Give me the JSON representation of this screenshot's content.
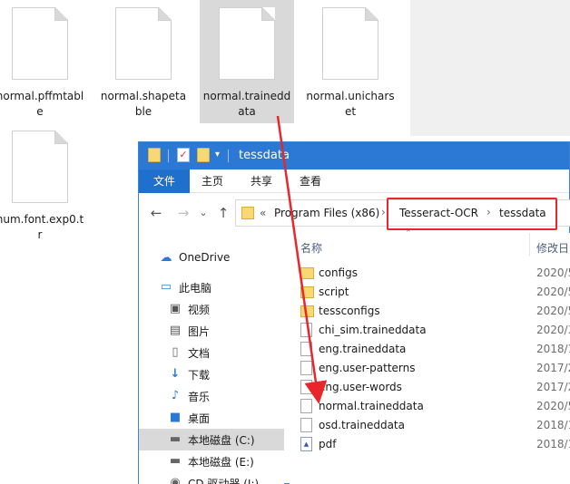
{
  "background_folder": {
    "files": [
      {
        "name": "normal.pffmtable",
        "selected": false
      },
      {
        "name": "normal.shapetable",
        "selected": false
      },
      {
        "name": "normal.traineddata",
        "selected": true
      },
      {
        "name": "normal.unicharset",
        "selected": false
      },
      {
        "name": "num.font.exp0.tr",
        "selected": false
      }
    ]
  },
  "window": {
    "title": "tessdata",
    "quick_access_icons": [
      "folder-icon",
      "properties-icon",
      "new-folder-icon",
      "dropdown-icon"
    ],
    "tabs": [
      "文件",
      "主页",
      "共享",
      "查看"
    ],
    "address": {
      "overflow": "«",
      "crumbs": [
        "Program Files (x86)",
        "Tesseract-OCR",
        "tessdata"
      ],
      "separator": "›"
    },
    "nav": {
      "back": "←",
      "forward": "→",
      "recent": "⌄",
      "up": "↑"
    },
    "sidebar": [
      {
        "label": "OneDrive",
        "icon": "cloud-icon",
        "active": false
      },
      {
        "label": "此电脑",
        "icon": "computer-icon",
        "active": false
      },
      {
        "label": "视频",
        "icon": "video-icon",
        "active": false
      },
      {
        "label": "图片",
        "icon": "pictures-icon",
        "active": false
      },
      {
        "label": "文档",
        "icon": "documents-icon",
        "active": false
      },
      {
        "label": "下载",
        "icon": "download-icon",
        "active": false
      },
      {
        "label": "音乐",
        "icon": "music-icon",
        "active": false
      },
      {
        "label": "桌面",
        "icon": "desktop-icon",
        "active": false
      },
      {
        "label": "本地磁盘 (C:)",
        "icon": "drive-icon",
        "active": true
      },
      {
        "label": "本地磁盘 (E:)",
        "icon": "drive-icon",
        "active": false
      },
      {
        "label": "CD 驱动器 (I:)",
        "icon": "cd-drive-icon",
        "active": false
      }
    ],
    "columns": {
      "name": "名称",
      "date": "修改日"
    },
    "files": [
      {
        "name": "configs",
        "type": "folder",
        "date": "2020/5"
      },
      {
        "name": "script",
        "type": "folder",
        "date": "2020/5"
      },
      {
        "name": "tessconfigs",
        "type": "folder",
        "date": "2020/5"
      },
      {
        "name": "chi_sim.traineddata",
        "type": "file",
        "date": "2020/3"
      },
      {
        "name": "eng.traineddata",
        "type": "file",
        "date": "2018/1"
      },
      {
        "name": "eng.user-patterns",
        "type": "file",
        "date": "2017/2"
      },
      {
        "name": "eng.user-words",
        "type": "file",
        "date": "2017/2"
      },
      {
        "name": "normal.traineddata",
        "type": "file",
        "date": "2020/5"
      },
      {
        "name": "osd.traineddata",
        "type": "file",
        "date": "2018/1"
      },
      {
        "name": "pdf",
        "type": "pdf",
        "date": "2018/1"
      }
    ]
  },
  "annotation": {
    "arrow_color": "#e8262c",
    "highlight_color": "#e8262c"
  }
}
